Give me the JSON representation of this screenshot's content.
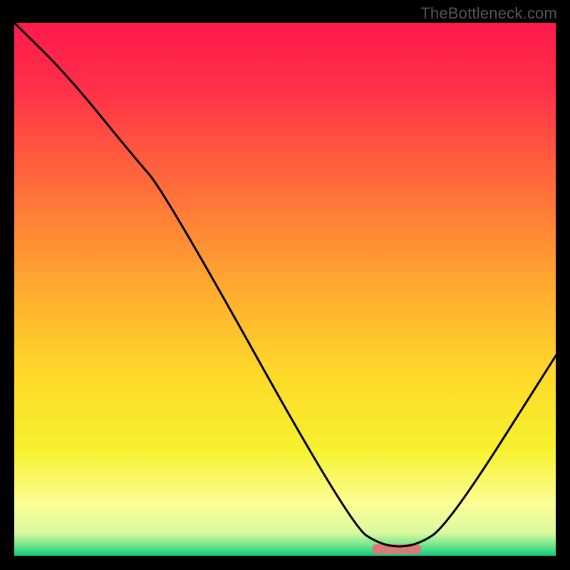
{
  "watermark": "TheBottleneck.com",
  "chart_data": {
    "type": "line",
    "title": "",
    "xlabel": "",
    "ylabel": "",
    "xlim": [
      0,
      100
    ],
    "ylim": [
      0,
      100
    ],
    "grid": false,
    "legend": false,
    "background_gradient": {
      "stops": [
        {
          "pos": 0.0,
          "color": "#ff1a4b"
        },
        {
          "pos": 0.12,
          "color": "#ff2e4a"
        },
        {
          "pos": 0.3,
          "color": "#ff6a3a"
        },
        {
          "pos": 0.48,
          "color": "#ffa531"
        },
        {
          "pos": 0.66,
          "color": "#ffd92a"
        },
        {
          "pos": 0.8,
          "color": "#f6f22e"
        },
        {
          "pos": 0.9,
          "color": "#fdfd96"
        },
        {
          "pos": 0.955,
          "color": "#d9f9a0"
        },
        {
          "pos": 0.975,
          "color": "#7fe88e"
        },
        {
          "pos": 1.0,
          "color": "#00c97b"
        }
      ]
    },
    "series": [
      {
        "name": "bottleneck-curve",
        "x": [
          0,
          10,
          22,
          28,
          62,
          68,
          74,
          80,
          100
        ],
        "y": [
          100,
          90,
          75,
          68,
          6,
          2,
          2,
          6,
          38
        ]
      }
    ],
    "marker": {
      "name": "optimal-point",
      "x_range": [
        66,
        75
      ],
      "y": 1.5,
      "color": "#d87a7a"
    }
  }
}
